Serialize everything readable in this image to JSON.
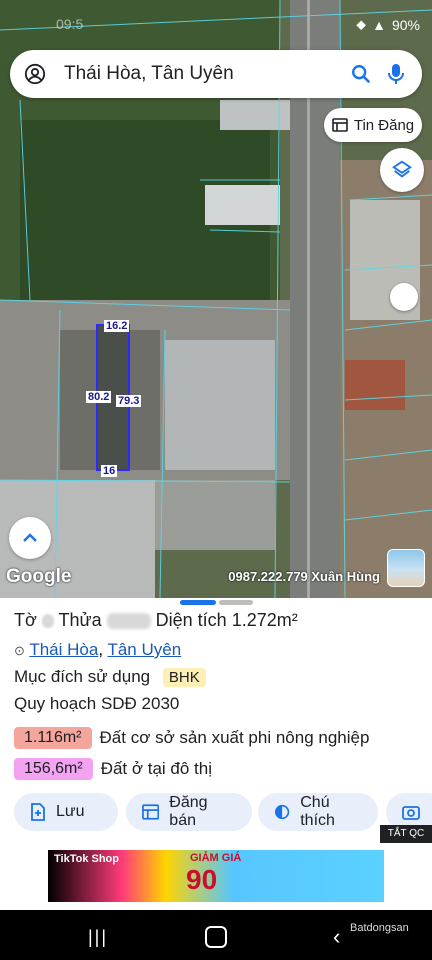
{
  "status": {
    "time": "09:5",
    "battery": "90%"
  },
  "search": {
    "query": "Thái Hòa, Tân Uyên"
  },
  "map": {
    "tin_dang_label": "Tin Đăng",
    "google_logo": "Google",
    "contact": "0987.222.779 Xuân Hùng",
    "dims": {
      "top": "16.2",
      "left": "80.2",
      "right": "79.3",
      "bottom": "16"
    }
  },
  "info": {
    "to_label": "Tờ",
    "thua_label": "Thửa",
    "dien_tich_label": "Diện tích",
    "dien_tich_value": "1.272m²",
    "ward": "Thái Hòa",
    "separator": ",",
    "district": "Tân Uyên",
    "purpose_label": "Mục đích sử dụng",
    "purpose_code": "BHK",
    "plan_label": "Quy hoạch SDĐ 2030",
    "areas": [
      {
        "value": "1.116m²",
        "desc": "Đất cơ sở sản xuất phi nông nghiệp",
        "color": "#f4a59c"
      },
      {
        "value": "156,6m²",
        "desc": "Đất ở tại đô thị",
        "color": "#f4a3f2"
      }
    ]
  },
  "actions": {
    "save": "Lưu",
    "post": "Đăng bán",
    "legend": "Chú thích",
    "close_ads": "TẮT QC"
  },
  "ad": {
    "brand": "TikTok Shop",
    "promo": "GIẢM GIÁ",
    "percent": "90"
  },
  "watermark": "Batdongsan"
}
